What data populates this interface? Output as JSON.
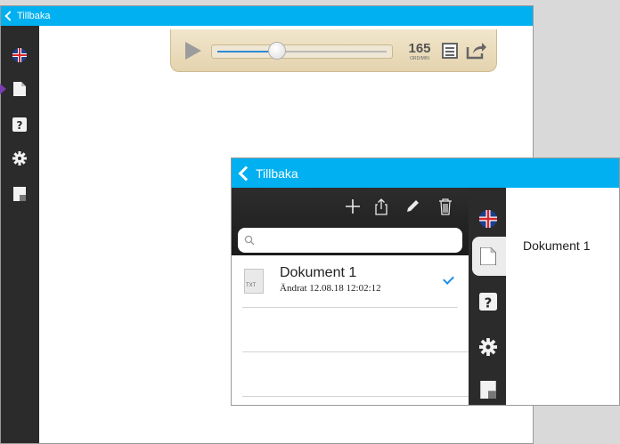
{
  "back_window": {
    "back_label": "Tillbaka",
    "player": {
      "speed_value": "165",
      "speed_unit": "ORD/MIN",
      "progress": 0.35
    }
  },
  "front_window": {
    "back_label": "Tillbaka",
    "toolbar": {
      "icons": [
        "add-icon",
        "share-icon",
        "edit-pencil-icon",
        "trash-icon"
      ]
    },
    "search": {
      "placeholder": "",
      "value": ""
    },
    "documents": [
      {
        "title": "Dokument 1",
        "subtitle": "Ändrat 12.08.18 12:02:12",
        "file_type": "TXT",
        "selected": true
      }
    ],
    "main_title": "Dokument 1"
  },
  "rail_icons": [
    "uk-flag-icon",
    "document-icon",
    "help-icon",
    "gear-icon",
    "window-icon"
  ],
  "colors": {
    "accent": "#00b0f0",
    "rail": "#2b2b2b",
    "player_bg": "#eadcbd",
    "check": "#1c8ee6"
  }
}
